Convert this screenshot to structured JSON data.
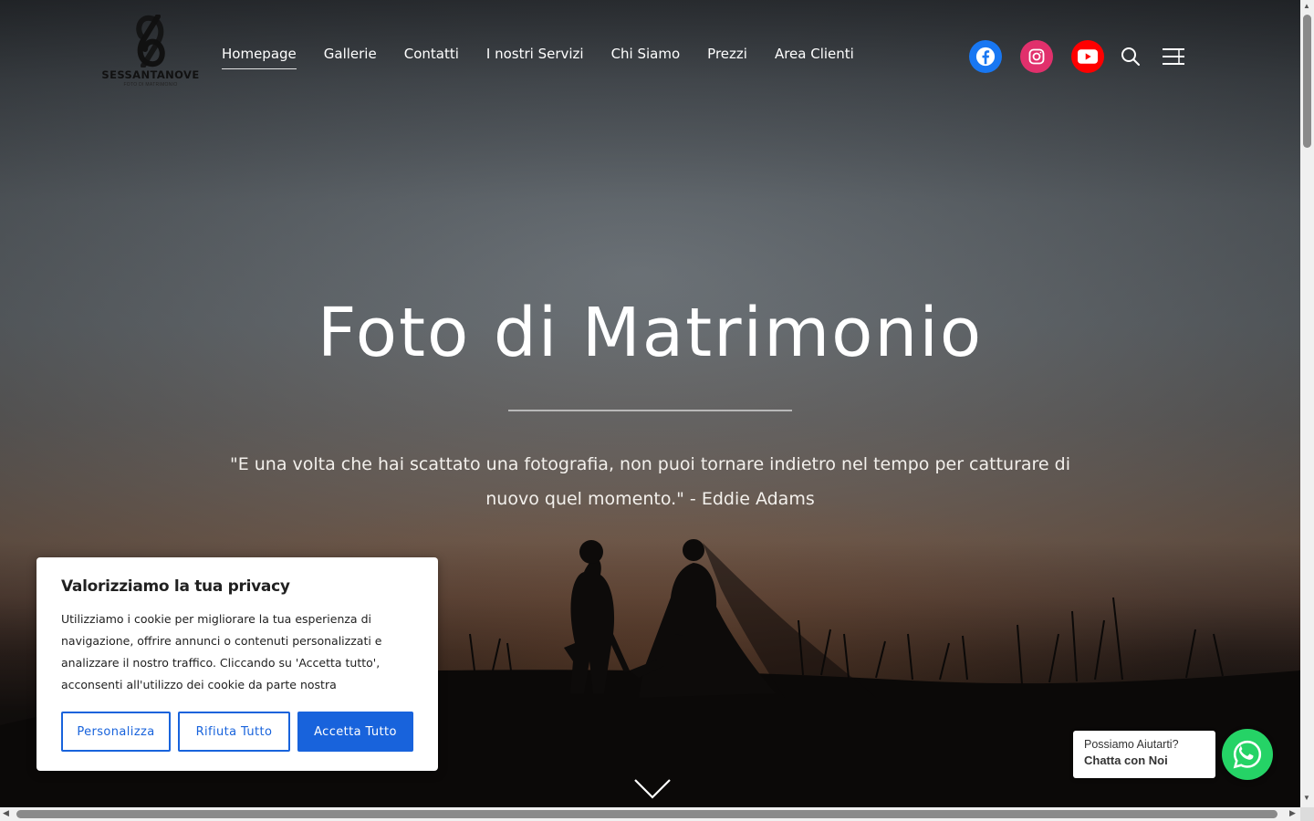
{
  "header": {
    "logo_text": "SESSANTANOVE",
    "logo_subtext": "FOTO DI MATRIMONIO",
    "nav": [
      {
        "label": "Homepage",
        "active": true
      },
      {
        "label": "Gallerie"
      },
      {
        "label": "Contatti"
      },
      {
        "label": "I nostri Servizi"
      },
      {
        "label": "Chi Siamo"
      },
      {
        "label": "Prezzi"
      },
      {
        "label": "Area Clienti"
      }
    ],
    "social": [
      {
        "icon": "facebook-icon",
        "color": "#1877f2"
      },
      {
        "icon": "instagram-icon",
        "color": "#e1306c"
      },
      {
        "icon": "youtube-icon",
        "color": "#ff0000"
      }
    ]
  },
  "hero": {
    "title": "Foto di Matrimonio",
    "quote": "\"E una volta che hai scattato una fotografia, non puoi tornare indietro nel tempo per catturare di nuovo quel momento.\" - Eddie Adams"
  },
  "cookie_banner": {
    "title": "Valorizziamo la tua privacy",
    "text": "Utilizziamo i cookie per migliorare la tua esperienza di navigazione, offrire annunci o contenuti personalizzati e analizzare il nostro traffico. Cliccando su 'Accetta tutto', acconsenti all'utilizzo dei cookie da parte nostra",
    "buttons": {
      "customize": "Personalizza",
      "reject": "Rifiuta Tutto",
      "accept": "Accetta Tutto"
    },
    "accent_color": "#1863dc"
  },
  "whatsapp": {
    "line1": "Possiamo Aiutarti?",
    "line2": "Chatta con Noi",
    "color": "#25d366"
  }
}
